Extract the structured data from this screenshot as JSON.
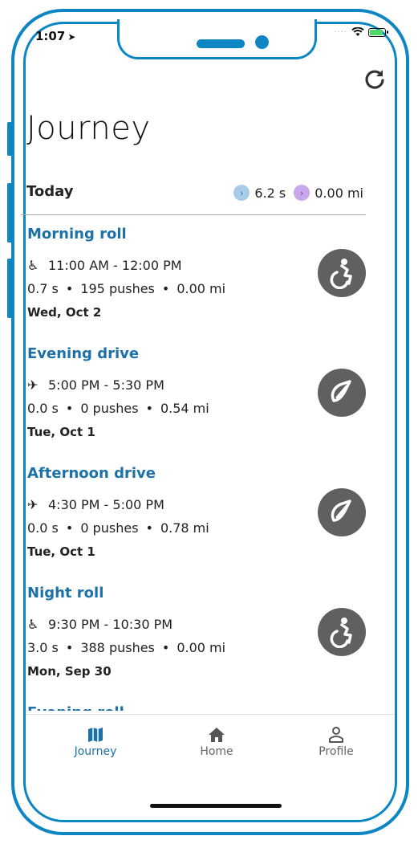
{
  "status_bar": {
    "time": "1:07",
    "battery_color": "#4cd964"
  },
  "header": {
    "title": "Journey"
  },
  "today": {
    "label": "Today",
    "coast_time": "6.2 s",
    "distance": "0.00 mi",
    "coast_badge_color": "#a9cbe8",
    "distance_badge_color": "#c9a7ea"
  },
  "journeys": [
    {
      "title": "Morning roll",
      "mode": "roll",
      "time": "11:00 AM - 12:00 PM",
      "coast": "0.7 s",
      "pushes": "195 pushes",
      "distance": "0.00 mi",
      "date": "Wed, Oct 2"
    },
    {
      "title": "Evening drive",
      "mode": "drive",
      "time": "5:00 PM - 5:30 PM",
      "coast": "0.0 s",
      "pushes": "0 pushes",
      "distance": "0.54 mi",
      "date": "Tue, Oct 1"
    },
    {
      "title": "Afternoon drive",
      "mode": "drive",
      "time": "4:30 PM - 5:00 PM",
      "coast": "0.0 s",
      "pushes": "0 pushes",
      "distance": "0.78 mi",
      "date": "Tue, Oct 1"
    },
    {
      "title": "Night roll",
      "mode": "roll",
      "time": "9:30 PM - 10:30 PM",
      "coast": "3.0 s",
      "pushes": "388 pushes",
      "distance": "0.00 mi",
      "date": "Mon, Sep 30"
    },
    {
      "title": "Evening roll",
      "mode": "roll",
      "time": "",
      "coast": "",
      "pushes": "",
      "distance": "",
      "date": ""
    }
  ],
  "tabs": [
    {
      "label": "Journey",
      "icon": "map-icon",
      "active": true
    },
    {
      "label": "Home",
      "icon": "home-icon",
      "active": false
    },
    {
      "label": "Profile",
      "icon": "person-icon",
      "active": false
    }
  ],
  "colors": {
    "accent": "#1b71a8",
    "frame": "#0d86c3",
    "icon_bg": "#606060"
  }
}
